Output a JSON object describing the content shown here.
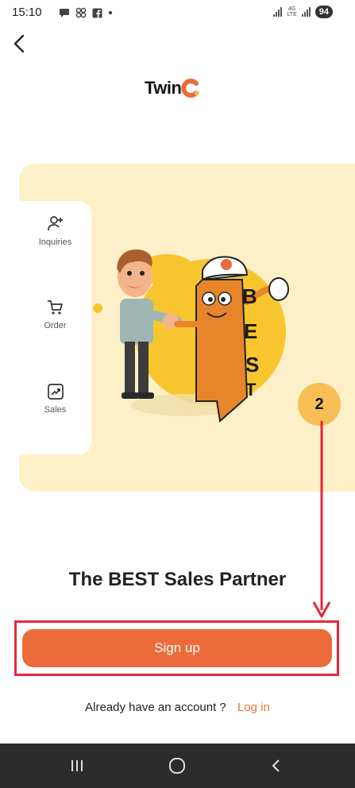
{
  "status_bar": {
    "time": "15:10",
    "network_label_top": "4G",
    "network_label_bottom": "LTE",
    "battery": "94"
  },
  "logo": {
    "text_prefix": "Twin",
    "text_suffix": "C"
  },
  "side_menu": {
    "items": [
      {
        "label": "Inquiries",
        "icon": "person-add-icon"
      },
      {
        "label": "Order",
        "icon": "cart-icon"
      },
      {
        "label": "Sales",
        "icon": "trend-chart-icon"
      }
    ]
  },
  "mascot_text": "BEST",
  "step_badge": "2",
  "headline": "The BEST Sales Partner",
  "signup_label": "Sign up",
  "login_prompt": "Already have an account ?",
  "login_link": "Log in",
  "colors": {
    "accent": "#ec6b3b",
    "banner": "#fdf0c9",
    "highlight": "#e8253a",
    "badge": "#f6be55"
  }
}
